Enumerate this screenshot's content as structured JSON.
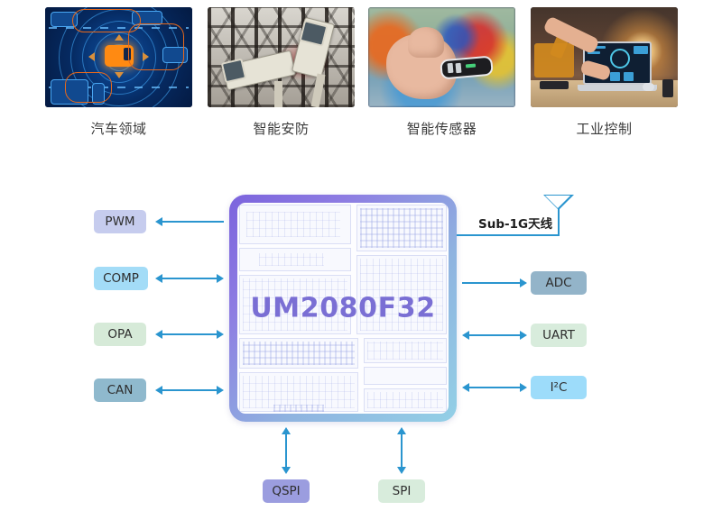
{
  "applications": [
    {
      "caption": "汽车领域",
      "image": "automotive-radar-illustration"
    },
    {
      "caption": "智能安防",
      "image": "security-cameras-photo"
    },
    {
      "caption": "智能传感器",
      "image": "handheld-sensor-photo"
    },
    {
      "caption": "工业控制",
      "image": "industrial-control-laptop-photo"
    }
  ],
  "diagram": {
    "chip_label": "UM2080F32",
    "antenna": {
      "label": "Sub-1G天线",
      "icon": "antenna-icon"
    },
    "left_peripherals": [
      {
        "label": "PWM",
        "color": "#c6ccee",
        "arrow": "single-left"
      },
      {
        "label": "COMP",
        "color": "#a3dcf7",
        "arrow": "double"
      },
      {
        "label": "OPA",
        "color": "#d6ead8",
        "arrow": "double"
      },
      {
        "label": "CAN",
        "color": "#8fb9cd",
        "arrow": "double"
      }
    ],
    "right_peripherals": [
      {
        "label": "ADC",
        "color": "#93b4c9",
        "arrow": "single-right"
      },
      {
        "label": "UART",
        "color": "#d8ecdc",
        "arrow": "double"
      },
      {
        "label": "I²C",
        "color": "#9ddcfa",
        "arrow": "double"
      }
    ],
    "bottom_peripherals": [
      {
        "label": "QSPI",
        "color": "#9b9ddf",
        "arrow": "double-vertical"
      },
      {
        "label": "SPI",
        "color": "#d8ecdc",
        "arrow": "double-vertical"
      }
    ],
    "colors": {
      "chip_border_start": "#7b63dd",
      "chip_border_end": "#93d0e6",
      "chip_text": "#7a6fd4",
      "connector": "#2a95cf",
      "caption_text": "#3a3a3a"
    }
  }
}
